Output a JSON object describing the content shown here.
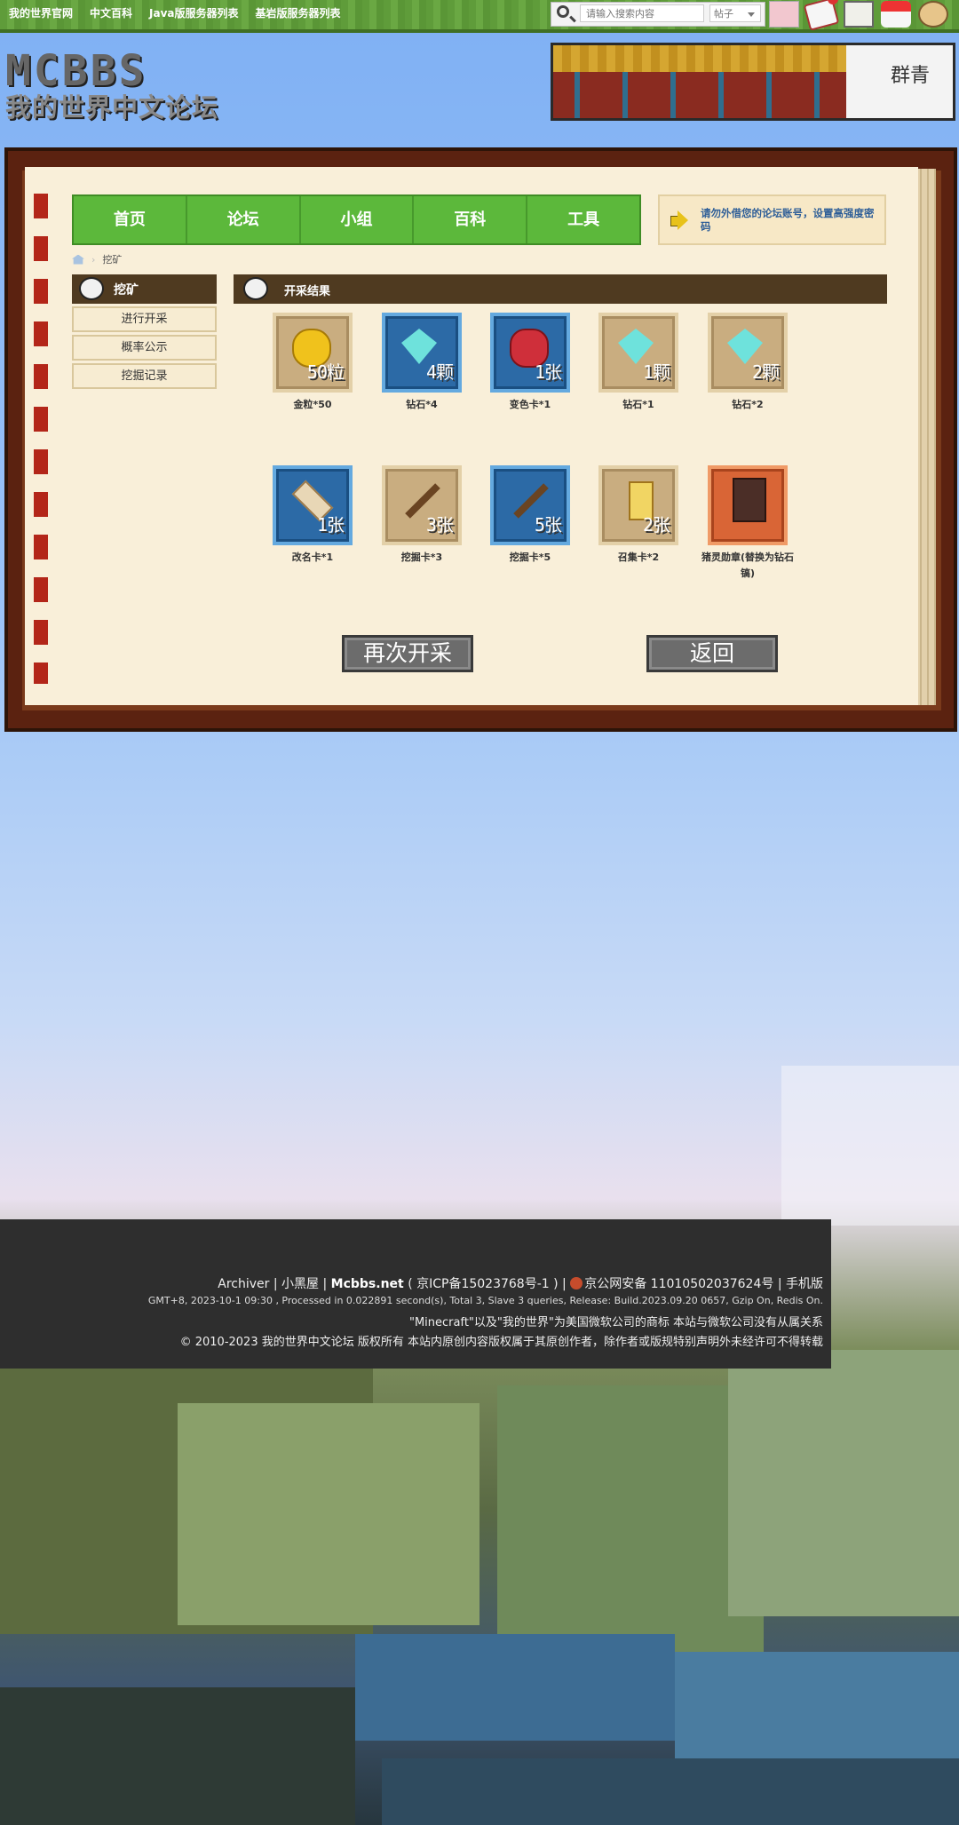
{
  "topbar": {
    "links": [
      "我的世界官网",
      "中文百科",
      "Java版服务器列表",
      "基岩版服务器列表"
    ],
    "search_placeholder": "请输入搜索内容",
    "search_type": "帖子"
  },
  "header": {
    "logo_text": "MCBBS",
    "logo_sub": "我的世界中文论坛",
    "banner_text": "群青"
  },
  "nav": {
    "items": [
      "首页",
      "论坛",
      "小组",
      "百科",
      "工具"
    ],
    "notice": "请勿外借您的论坛账号，设置高强度密码"
  },
  "breadcrumb": {
    "current": "挖矿"
  },
  "sidebar": {
    "title": "挖矿",
    "items": [
      "进行开采",
      "概率公示",
      "挖掘记录"
    ]
  },
  "main": {
    "title": "开采结果",
    "rewards": [
      {
        "qty": "50粒",
        "label": "金粒*50",
        "style": "tan",
        "icon": "gold-nugget-icon"
      },
      {
        "qty": "4颗",
        "label": "钻石*4",
        "style": "blue",
        "icon": "diamond-icon"
      },
      {
        "qty": "1张",
        "label": "变色卡*1",
        "style": "blue",
        "icon": "dye-icon"
      },
      {
        "qty": "1颗",
        "label": "钻石*1",
        "style": "tan",
        "icon": "diamond-icon"
      },
      {
        "qty": "2颗",
        "label": "钻石*2",
        "style": "tan",
        "icon": "diamond-icon"
      },
      {
        "qty": "1张",
        "label": "改名卡*1",
        "style": "blue",
        "icon": "name-tag-icon"
      },
      {
        "qty": "3张",
        "label": "挖掘卡*3",
        "style": "tan",
        "icon": "shovel-icon"
      },
      {
        "qty": "5张",
        "label": "挖掘卡*5",
        "style": "blue",
        "icon": "shovel-icon"
      },
      {
        "qty": "2张",
        "label": "召集卡*2",
        "style": "tan",
        "icon": "scroll-icon"
      },
      {
        "qty": "",
        "label": "猪灵勋章(替换为钻石镐)",
        "style": "orange",
        "icon": "badge-icon"
      }
    ],
    "again_button": "再次开采",
    "back_button": "返回"
  },
  "footer": {
    "line1_pre": "Archiver | 小黑屋 | ",
    "line1_site": "Mcbbs.net",
    "line1_post": " ( 京ICP备15023768号-1 ) | ",
    "line1_police": "京公网安备 11010502037624号",
    "line1_mobile": " | 手机版",
    "line2": "GMT+8, 2023-10-1 09:30 , Processed in 0.022891 second(s), Total 3, Slave 3 queries, Release: Build.2023.09.20 0657, Gzip On, Redis On.",
    "line3": "\"Minecraft\"以及\"我的世界\"为美国微软公司的商标 本站与微软公司没有从属关系",
    "line4": "© 2010-2023 我的世界中文论坛 版权所有 本站内原创内容版权属于其原创作者，除作者或版规特别声明外未经许可不得转载"
  },
  "colors": {
    "nav_green": "#5cb83b",
    "frame_brown": "#5b2210",
    "paper": "#f9efd9",
    "notice_blue": "#2f5f98"
  }
}
